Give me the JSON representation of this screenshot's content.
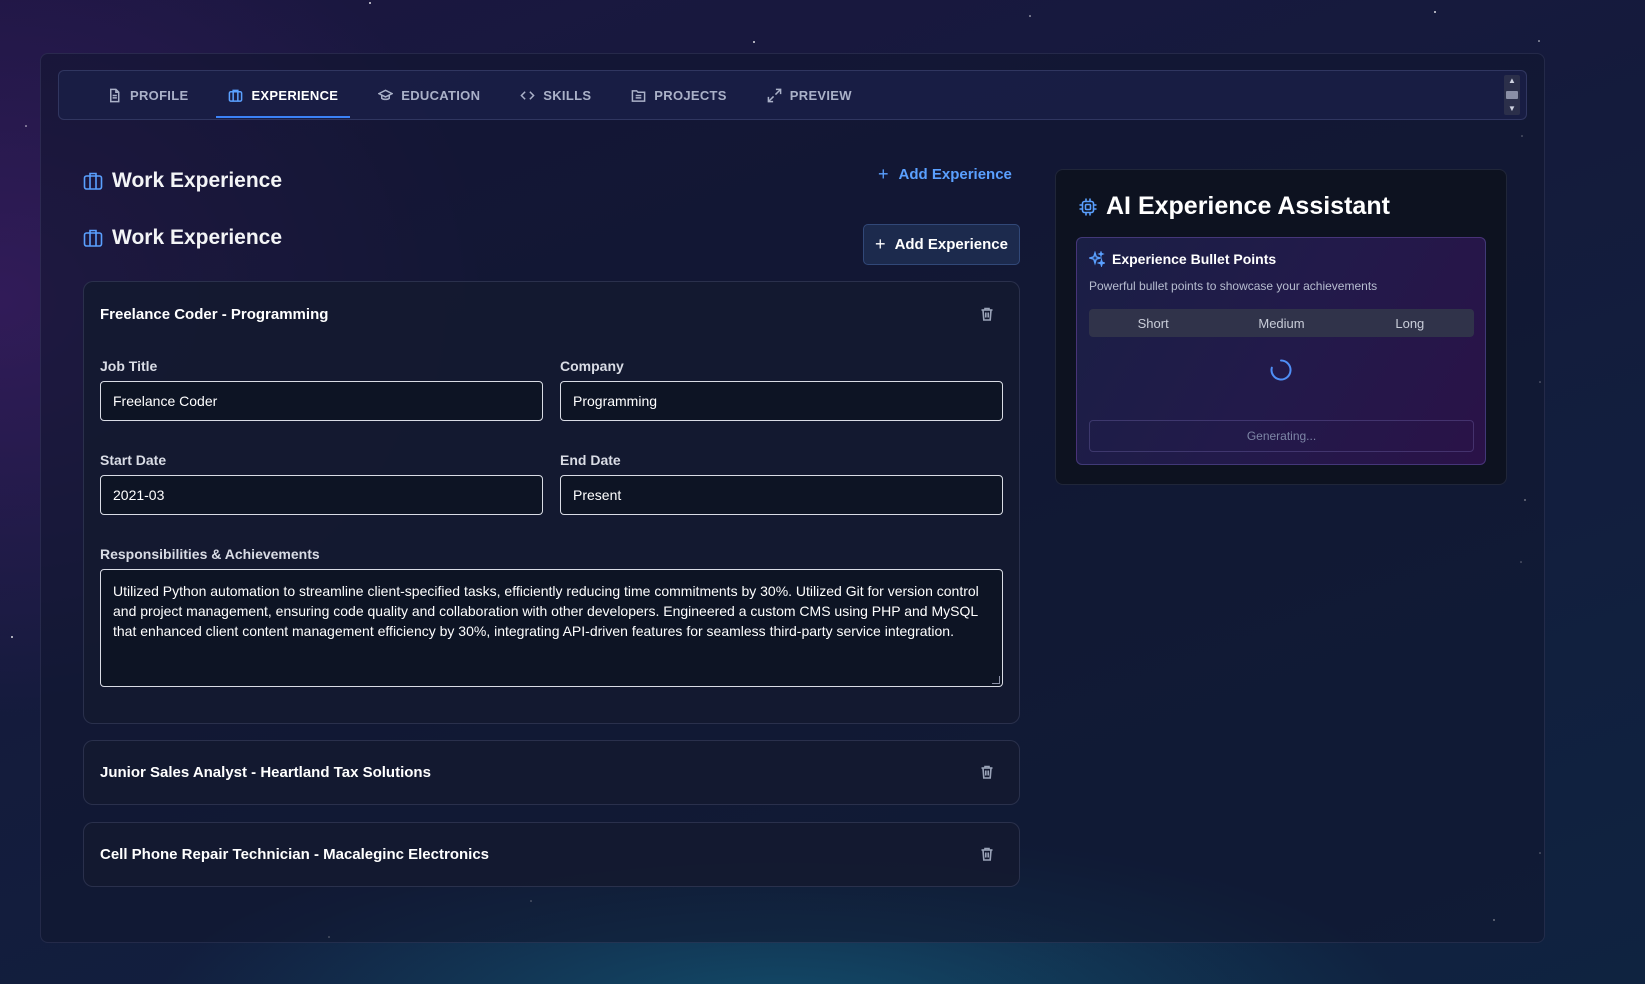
{
  "tabs": [
    {
      "label": "PROFILE",
      "icon": "document-icon",
      "active": false
    },
    {
      "label": "EXPERIENCE",
      "icon": "briefcase-icon",
      "active": true
    },
    {
      "label": "EDUCATION",
      "icon": "graduation-cap-icon",
      "active": false
    },
    {
      "label": "SKILLS",
      "icon": "code-icon",
      "active": false
    },
    {
      "label": "PROJECTS",
      "icon": "folder-icon",
      "active": false
    },
    {
      "label": "PREVIEW",
      "icon": "expand-icon",
      "active": false
    }
  ],
  "section": {
    "title": "Work Experience",
    "add_label": "Add Experience"
  },
  "experiences": [
    {
      "heading": "Freelance Coder - Programming",
      "expanded": true,
      "fields": {
        "job_title_label": "Job Title",
        "job_title": "Freelance Coder",
        "company_label": "Company",
        "company": "Programming",
        "start_date_label": "Start Date",
        "start_date": "2021-03",
        "end_date_label": "End Date",
        "end_date": "Present",
        "responsibilities_label": "Responsibilities & Achievements",
        "responsibilities": "Utilized Python automation to streamline client-specified tasks, efficiently reducing time commitments by 30%. Utilized Git for version control and project management, ensuring code quality and collaboration with other developers. Engineered a custom CMS using PHP and MySQL that enhanced client content management efficiency by 30%, integrating API-driven features for seamless third-party service integration."
      }
    },
    {
      "heading": "Junior Sales Analyst - Heartland Tax Solutions",
      "expanded": false
    },
    {
      "heading": "Cell Phone Repair Technician - Macaleginc Electronics",
      "expanded": false
    }
  ],
  "ai_assistant": {
    "title": "AI Experience Assistant",
    "card_title": "Experience Bullet Points",
    "card_subtitle": "Powerful bullet points to showcase your achievements",
    "lengths": [
      "Short",
      "Medium",
      "Long"
    ],
    "generate_label": "Generating..."
  },
  "colors": {
    "accent": "#3b82f6",
    "accent_light": "#5aa0ff",
    "panel": "#0d1220",
    "input_bg": "#0d1424"
  }
}
